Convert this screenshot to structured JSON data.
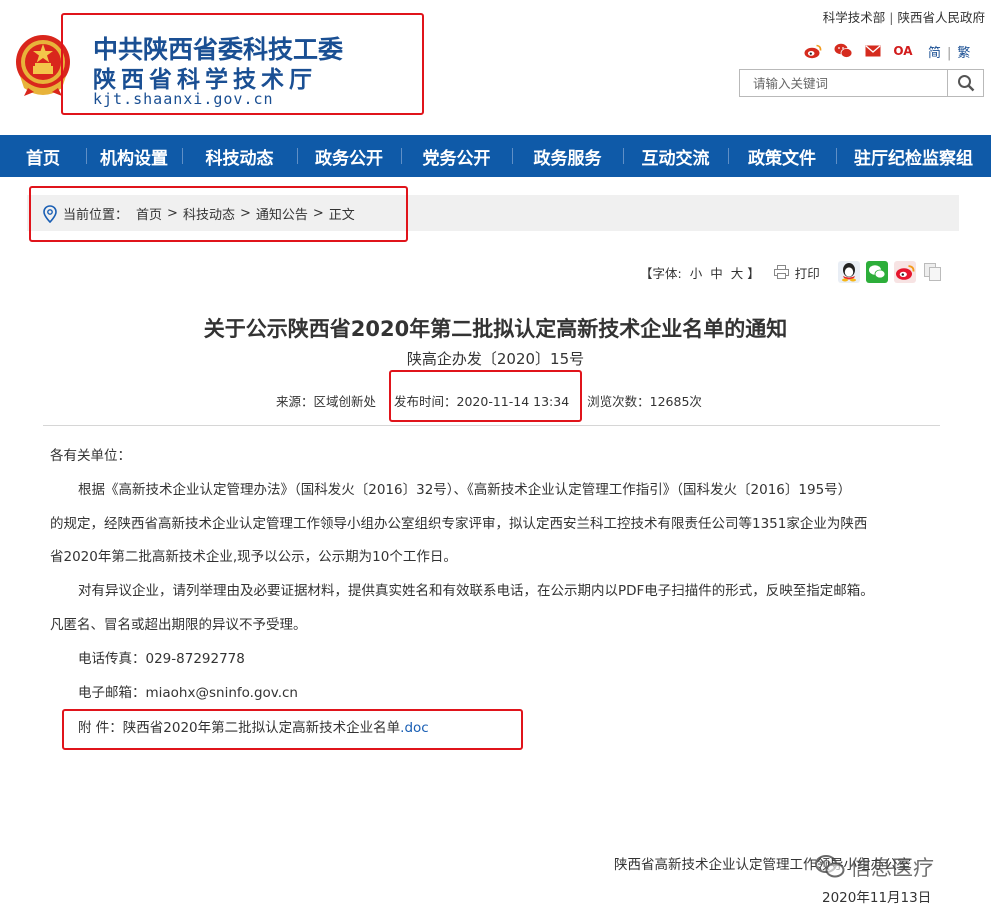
{
  "header": {
    "logo_line1": "中共陕西省委科技工委",
    "logo_line2": "陕西省科学技术厅",
    "logo_url": "kjt.shaanxi.gov.cn",
    "top_links": [
      "科学技术部",
      "陕西省人民政府"
    ],
    "top_sep": "|",
    "icons": [
      "weibo-icon",
      "wechat-icon",
      "mail-icon",
      "oa-icon"
    ],
    "oa_label": "OA",
    "lang_simplified": "简",
    "lang_sep": "|",
    "lang_traditional": "繁",
    "search_placeholder": "请输入关键词"
  },
  "nav": {
    "items": [
      "首页",
      "机构设置",
      "科技动态",
      "政务公开",
      "党务公开",
      "政务服务",
      "互动交流",
      "政策文件",
      "驻厅纪检监察组"
    ]
  },
  "breadcrumb": {
    "label": "当前位置：",
    "items": [
      "首页",
      "科技动态",
      "通知公告",
      "正文"
    ],
    "sep": ">"
  },
  "tools": {
    "font_label_open": "【字体:",
    "font_small": "小",
    "font_medium": "中",
    "font_large": "大",
    "font_label_close": "】",
    "print_label": "打印"
  },
  "article": {
    "title": "关于公示陕西省2020年第二批拟认定高新技术企业名单的通知",
    "doc_number": "陕高企办发〔2020〕15号",
    "source": "来源：区域创新处",
    "publish_time": "发布时间：2020-11-14 13:34",
    "views": "浏览次数：12685次",
    "greeting": "各有关单位：",
    "para1_line1": "根据《高新技术企业认定管理办法》（国科发火〔2016〕32号）、《高新技术企业认定管理工作指引》（国科发火〔2016〕195号）",
    "para1_line2": "的规定，经陕西省高新技术企业认定管理工作领导小组办公室组织专家评审，拟认定西安兰科工控技术有限责任公司等1351家企业为陕西",
    "para1_line3": "省2020年第二批高新技术企业,现予以公示，公示期为10个工作日。",
    "para2_line1": "对有异议企业，请列举理由及必要证据材料，提供真实姓名和有效联系电话，在公示期内以PDF电子扫描件的形式，反映至指定邮箱。",
    "para2_line2": "凡匿名、冒名或超出期限的异议不予受理。",
    "phone": "电话传真：029-87292778",
    "email": "电子邮箱：miaohx@sninfo.gov.cn",
    "attachment_label": "附 件：陕西省2020年第二批拟认定高新技术企业名单",
    "attachment_link": ".doc",
    "signature_org": "陕西省高新技术企业认定管理工作领导小组办公室",
    "signature_date": "2020年11月13日"
  },
  "watermark": "信息医疗",
  "colors": {
    "brand_blue": "#0f5aa8",
    "logo_blue": "#1a4f93",
    "highlight_red": "#e0141b",
    "link_blue": "#1a5fb4"
  }
}
